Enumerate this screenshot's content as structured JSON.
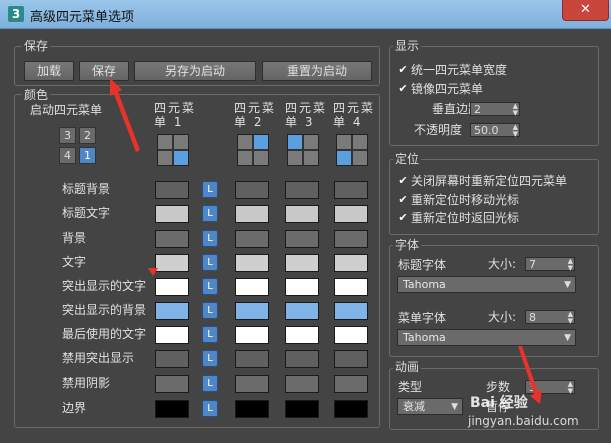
{
  "window": {
    "title": "高级四元菜单选项",
    "icon_text": "3",
    "close_glyph": "✕"
  },
  "save": {
    "group_label": "保存",
    "buttons": [
      "加载",
      "保存",
      "另存为启动",
      "重置为启动"
    ]
  },
  "colors": {
    "group_label": "颜色",
    "start_quad_label": "启动四元菜单",
    "quad_numbers": [
      "3",
      "2",
      "4",
      "1"
    ],
    "selected_number": "1",
    "quad_headers": [
      "四元菜单 1",
      "四元菜单 2",
      "四元菜单 3",
      "四元菜单 4"
    ],
    "l_button": "L",
    "rows": [
      {
        "label": "标题背景",
        "colors": [
          "#606060",
          "#606060",
          "#606060",
          "#606060"
        ]
      },
      {
        "label": "标题文字",
        "colors": [
          "#c8c8c8",
          "#c8c8c8",
          "#c8c8c8",
          "#c8c8c8"
        ]
      },
      {
        "label": "背景",
        "colors": [
          "#6b6b6b",
          "#6b6b6b",
          "#6b6b6b",
          "#6b6b6b"
        ]
      },
      {
        "label": "文字",
        "colors": [
          "#cfcfcf",
          "#cfcfcf",
          "#cfcfcf",
          "#cfcfcf"
        ]
      },
      {
        "label": "突出显示的文字",
        "colors": [
          "#ffffff",
          "#ffffff",
          "#ffffff",
          "#ffffff"
        ]
      },
      {
        "label": "突出显示的背景",
        "colors": [
          "#7fb4e8",
          "#7fb4e8",
          "#7fb4e8",
          "#7fb4e8"
        ]
      },
      {
        "label": "最后使用的文字",
        "colors": [
          "#ffffff",
          "#ffffff",
          "#ffffff",
          "#ffffff"
        ]
      },
      {
        "label": "禁用突出显示",
        "colors": [
          "#606060",
          "#606060",
          "#606060",
          "#606060"
        ]
      },
      {
        "label": "禁用阴影",
        "colors": [
          "#6b6b6b",
          "#6b6b6b",
          "#6b6b6b",
          "#6b6b6b"
        ]
      },
      {
        "label": "边界",
        "colors": [
          "#000000",
          "#000000",
          "#000000",
          "#000000"
        ]
      }
    ]
  },
  "display": {
    "group_label": "显示",
    "uniform_width": "统一四元菜单宽度",
    "mirror": "镜像四元菜单",
    "vmargin_label": "垂直边距",
    "vmargin_value": "2",
    "opacity_label": "不透明度",
    "opacity_value": "50.0",
    "check_glyph": "✔"
  },
  "position": {
    "group_label": "定位",
    "items": [
      "关闭屏幕时重新定位四元菜单",
      "重新定位时移动光标",
      "重新定位时返回光标"
    ]
  },
  "fonts": {
    "group_label": "字体",
    "title_font_label": "标题字体",
    "title_size_label": "大小:",
    "title_size": "7",
    "title_font": "Tahoma",
    "menu_font_label": "菜单字体",
    "menu_size_label": "大小:",
    "menu_size": "8",
    "menu_font": "Tahoma"
  },
  "animation": {
    "group_label": "动画",
    "type_label": "类型",
    "type_value": "衰减",
    "steps_label": "步数",
    "steps_value": "3",
    "time_label": "暂停"
  },
  "watermark": {
    "line1": "Bai 经验",
    "line2": "jingyan.baidu.com"
  }
}
